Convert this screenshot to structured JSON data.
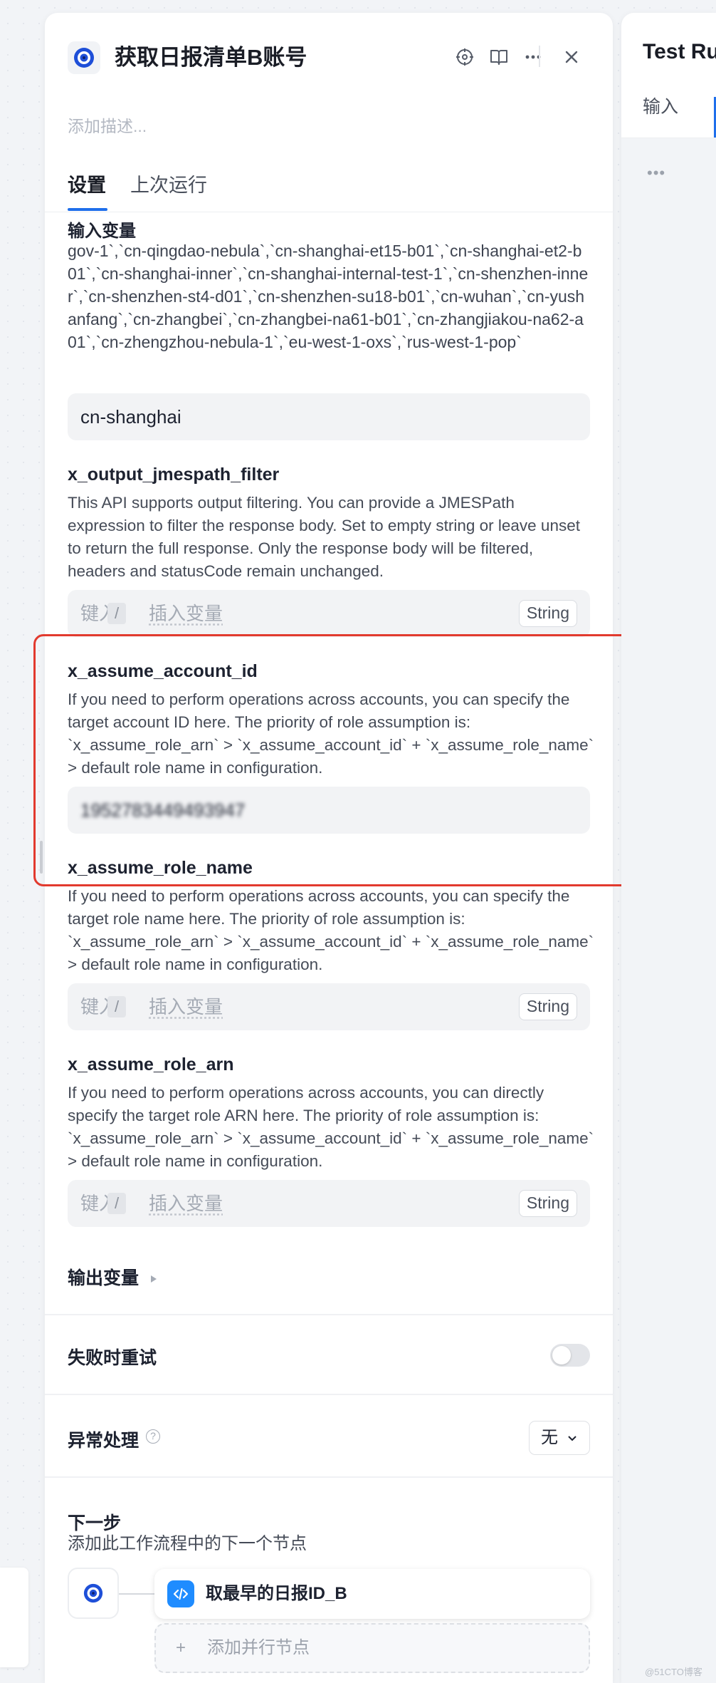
{
  "node": {
    "title": "获取日报清单B账号",
    "description_placeholder": "添加描述..."
  },
  "tabs": [
    {
      "label": "设置",
      "active": true
    },
    {
      "label": "上次运行",
      "active": false
    }
  ],
  "input_section": {
    "heading": "输入变量",
    "enum_text": "gov-1`,`cn-qingdao-nebula`,`cn-shanghai-et15-b01`,`cn-shanghai-et2-b01`,`cn-shanghai-inner`,`cn-shanghai-internal-test-1`,`cn-shenzhen-inner`,`cn-shenzhen-st4-d01`,`cn-shenzhen-su18-b01`,`cn-wuhan`,`cn-yushanfang`,`cn-zhangbei`,`cn-zhangbei-na61-b01`,`cn-zhangjiakou-na62-a01`,`cn-zhengzhou-nebula-1`,`eu-west-1-oxs`,`rus-west-1-pop`",
    "region_value": "cn-shanghai"
  },
  "fields": [
    {
      "name": "x_output_jmespath_filter",
      "description": "This API supports output filtering. You can provide a JMESPath expression to filter the response body. Set to empty string or leave unset to return the full response. Only the response body will be filtered, headers and statusCode remain unchanged.",
      "placeholder_left": "键入",
      "placeholder_slash": "/",
      "placeholder_right": "插入变量",
      "type": "String"
    },
    {
      "name": "x_assume_account_id",
      "description": "If you need to perform operations across accounts, you can specify the target account ID here. The priority of role assumption is: `x_assume_role_arn` > `x_assume_account_id` + `x_assume_role_name` > default role name in configuration.",
      "value": "1952783449493947"
    },
    {
      "name": "x_assume_role_name",
      "description": "If you need to perform operations across accounts, you can specify the target role name here. The priority of role assumption is: `x_assume_role_arn` > `x_assume_account_id` + `x_assume_role_name` > default role name in configuration.",
      "placeholder_left": "键入",
      "placeholder_slash": "/",
      "placeholder_right": "插入变量",
      "type": "String"
    },
    {
      "name": "x_assume_role_arn",
      "description": "If you need to perform operations across accounts, you can directly specify the target role ARN here. The priority of role assumption is: `x_assume_role_arn` > `x_assume_account_id` + `x_assume_role_name` > default role name in configuration.",
      "placeholder_left": "键入",
      "placeholder_slash": "/",
      "placeholder_right": "插入变量",
      "type": "String"
    }
  ],
  "output_section": {
    "label": "输出变量"
  },
  "retry": {
    "label": "失败时重试",
    "enabled": false
  },
  "error_handling": {
    "label": "异常处理",
    "help": "?",
    "value": "无"
  },
  "next_step": {
    "heading": "下一步",
    "description": "添加此工作流程中的下一个节点",
    "next_node_label": "取最早的日报ID_B",
    "add_parallel_plus": "+",
    "add_parallel_label": "添加并行节点"
  },
  "right_panel": {
    "title": "Test Ru",
    "tab": "输入",
    "dots": "•••"
  },
  "watermark": "@51CTO博客",
  "colors": {
    "accent": "#1f6feb",
    "highlight_box": "#e23a2e",
    "code_node": "#1f8cff"
  }
}
